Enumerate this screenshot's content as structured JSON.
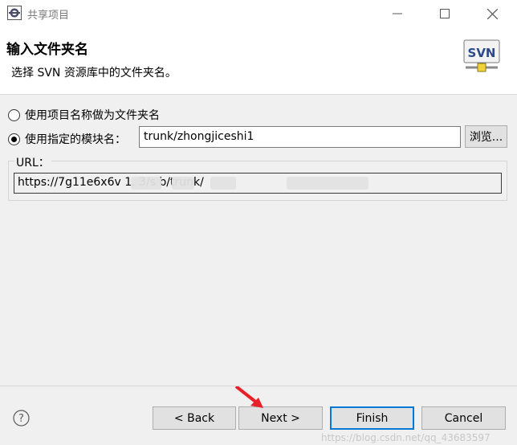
{
  "window": {
    "title": "共享项目",
    "minimize_icon": "minimize-icon",
    "maximize_icon": "maximize-icon",
    "close_icon": "close-icon"
  },
  "banner": {
    "title": "输入文件夹名",
    "description": "选择 SVN 资源库中的文件夹名。",
    "logo_text": "SVN"
  },
  "options": {
    "use_project_name_label": "使用项目名称做为文件夹名",
    "use_project_name_checked": false,
    "use_module_name_label": "使用指定的模块名：",
    "use_module_name_checked": true,
    "module_name_value": "trunk/zhongjiceshi1",
    "browse_label": "浏览..."
  },
  "url": {
    "label": "URL：",
    "value": "https://7g11e6x6v        1.    3/s      b/trunk/"
  },
  "footer": {
    "back_label": "< Back",
    "next_label": "Next >",
    "finish_label": "Finish",
    "cancel_label": "Cancel",
    "watermark": "https://blog.csdn.net/qq_43683597"
  },
  "colors": {
    "accent": "#0078d7",
    "content_bg": "#f0f0f0",
    "arrow": "#e8202a"
  }
}
